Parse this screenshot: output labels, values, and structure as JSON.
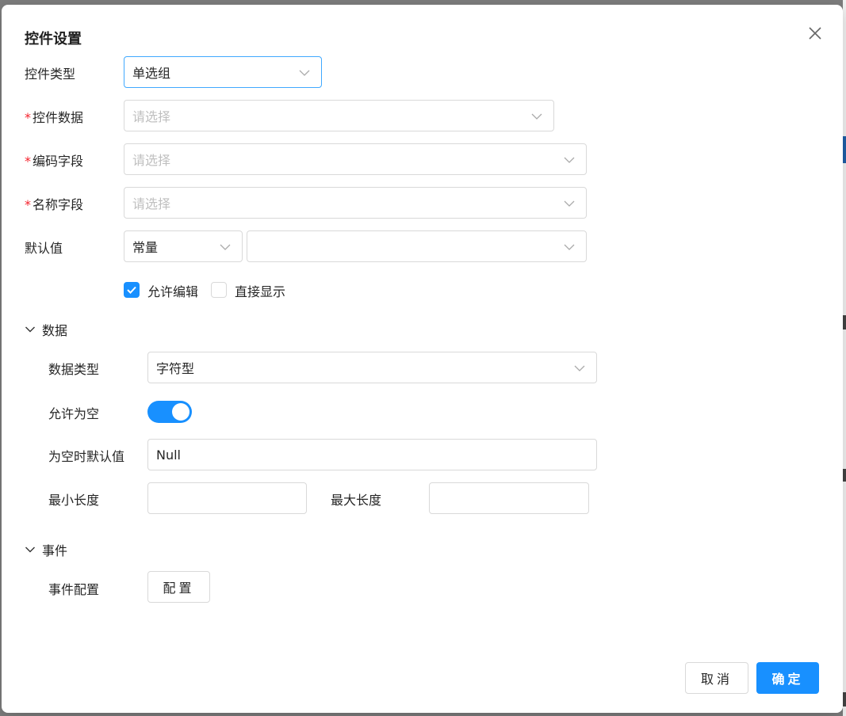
{
  "dialog": {
    "title": "控件设置"
  },
  "form": {
    "control_type": {
      "label": "控件类型",
      "value": "单选组"
    },
    "control_data": {
      "required_mark": "*",
      "label": "控件数据",
      "placeholder": "请选择"
    },
    "code_field": {
      "required_mark": "*",
      "label": "编码字段",
      "placeholder": "请选择"
    },
    "name_field": {
      "required_mark": "*",
      "label": "名称字段",
      "placeholder": "请选择"
    },
    "default_value": {
      "label": "默认值",
      "mode": "常量",
      "value": ""
    },
    "allow_edit": {
      "label": "允许编辑",
      "checked": true
    },
    "direct_display": {
      "label": "直接显示",
      "checked": false
    }
  },
  "data_section": {
    "title": "数据",
    "expanded": true,
    "data_type": {
      "label": "数据类型",
      "value": "字符型"
    },
    "allow_null": {
      "label": "允许为空",
      "on": true
    },
    "null_default": {
      "label": "为空时默认值",
      "value": "Null"
    },
    "min_length": {
      "label": "最小长度",
      "value": ""
    },
    "max_length": {
      "label": "最大长度",
      "value": ""
    }
  },
  "event_section": {
    "title": "事件",
    "expanded": true,
    "event_config": {
      "label": "事件配置",
      "button": "配置"
    }
  },
  "footer": {
    "cancel": "取消",
    "ok": "确定"
  },
  "colors": {
    "primary": "#1890ff",
    "required": "#f5222d",
    "border": "#d9d9d9",
    "placeholder": "#bfbfbf"
  }
}
